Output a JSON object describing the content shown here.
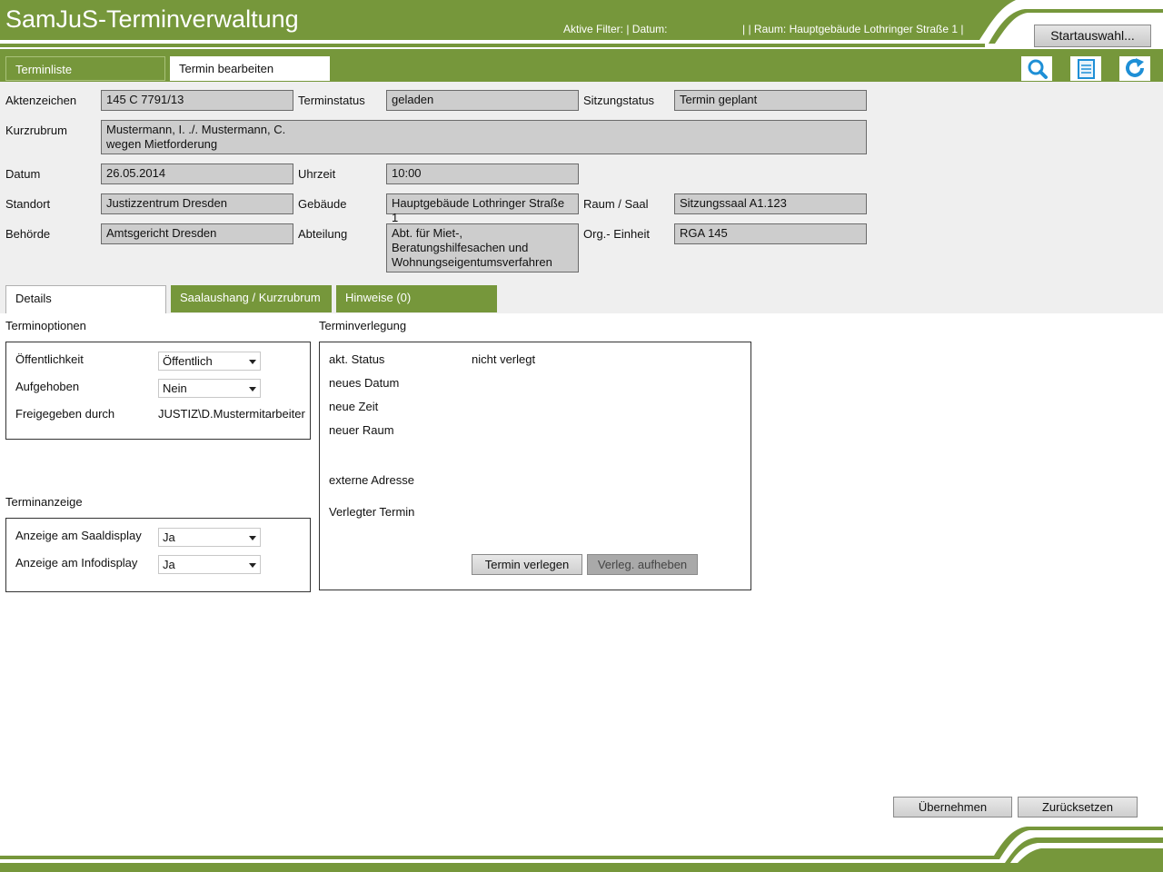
{
  "header": {
    "title": "SamJuS-Terminverwaltung",
    "filter": "Aktive Filter: | Datum:",
    "filter_room": "| | Raum: Hauptgebäude Lothringer Straße 1 |",
    "start_button": "Startauswahl..."
  },
  "tabs": {
    "list": "Terminliste",
    "edit": "Termin bearbeiten"
  },
  "toolbar_icons": [
    "search-icon",
    "document-icon",
    "refresh-icon"
  ],
  "form": {
    "aktenzeichen": {
      "label": "Aktenzeichen",
      "value": "145 C 7791/13"
    },
    "terminstatus": {
      "label": "Terminstatus",
      "value": "geladen"
    },
    "sitzungstatus": {
      "label": "Sitzungstatus",
      "value": "Termin geplant"
    },
    "kurzrubrum": {
      "label": "Kurzrubrum",
      "value": "Mustermann, I. ./. Mustermann, C.\nwegen Mietforderung"
    },
    "datum": {
      "label": "Datum",
      "value": "26.05.2014"
    },
    "uhrzeit": {
      "label": "Uhrzeit",
      "value": "10:00"
    },
    "standort": {
      "label": "Standort",
      "value": "Justizzentrum Dresden"
    },
    "gebaeude": {
      "label": "Gebäude",
      "value": "Hauptgebäude Lothringer Straße 1"
    },
    "raum": {
      "label": "Raum / Saal",
      "value": "Sitzungssaal A1.123"
    },
    "behoerde": {
      "label": "Behörde",
      "value": "Amtsgericht Dresden"
    },
    "abteilung": {
      "label": "Abteilung",
      "value": "Abt. für Miet-,\nBeratungshilfesachen und\nWohnungseigentumsverfahren"
    },
    "org": {
      "label": "Org.- Einheit",
      "value": "RGA 145"
    }
  },
  "subtabs": {
    "details": "Details",
    "saal": "Saalaushang / Kurzrubrum",
    "hinweise": "Hinweise (0)"
  },
  "terminoptionen": {
    "title": "Terminoptionen",
    "oeffentlichkeit": {
      "label": "Öffentlichkeit",
      "value": "Öffentlich"
    },
    "aufgehoben": {
      "label": "Aufgehoben",
      "value": "Nein"
    },
    "freigegeben": {
      "label": "Freigegeben durch",
      "value": "JUSTIZ\\D.Mustermitarbeiter"
    }
  },
  "terminanzeige": {
    "title": "Terminanzeige",
    "saaldisplay": {
      "label": "Anzeige am Saaldisplay",
      "value": "Ja"
    },
    "infodisplay": {
      "label": "Anzeige am Infodisplay",
      "value": "Ja"
    }
  },
  "terminverlegung": {
    "title": "Terminverlegung",
    "status_label": "akt. Status",
    "status_value": "nicht verlegt",
    "neues_datum": "neues Datum",
    "neue_zeit": "neue Zeit",
    "neuer_raum": "neuer Raum",
    "externe_adresse": "externe Adresse",
    "verlegter_termin": "Verlegter Termin",
    "btn_verlegen": "Termin verlegen",
    "btn_aufheben": "Verleg. aufheben"
  },
  "actions": {
    "uebernehmen": "Übernehmen",
    "zuruecksetzen": "Zurücksetzen"
  },
  "colors": {
    "brand_green": "#76973b",
    "field_gray": "#cdcdcd",
    "panel_gray": "#efefef"
  }
}
